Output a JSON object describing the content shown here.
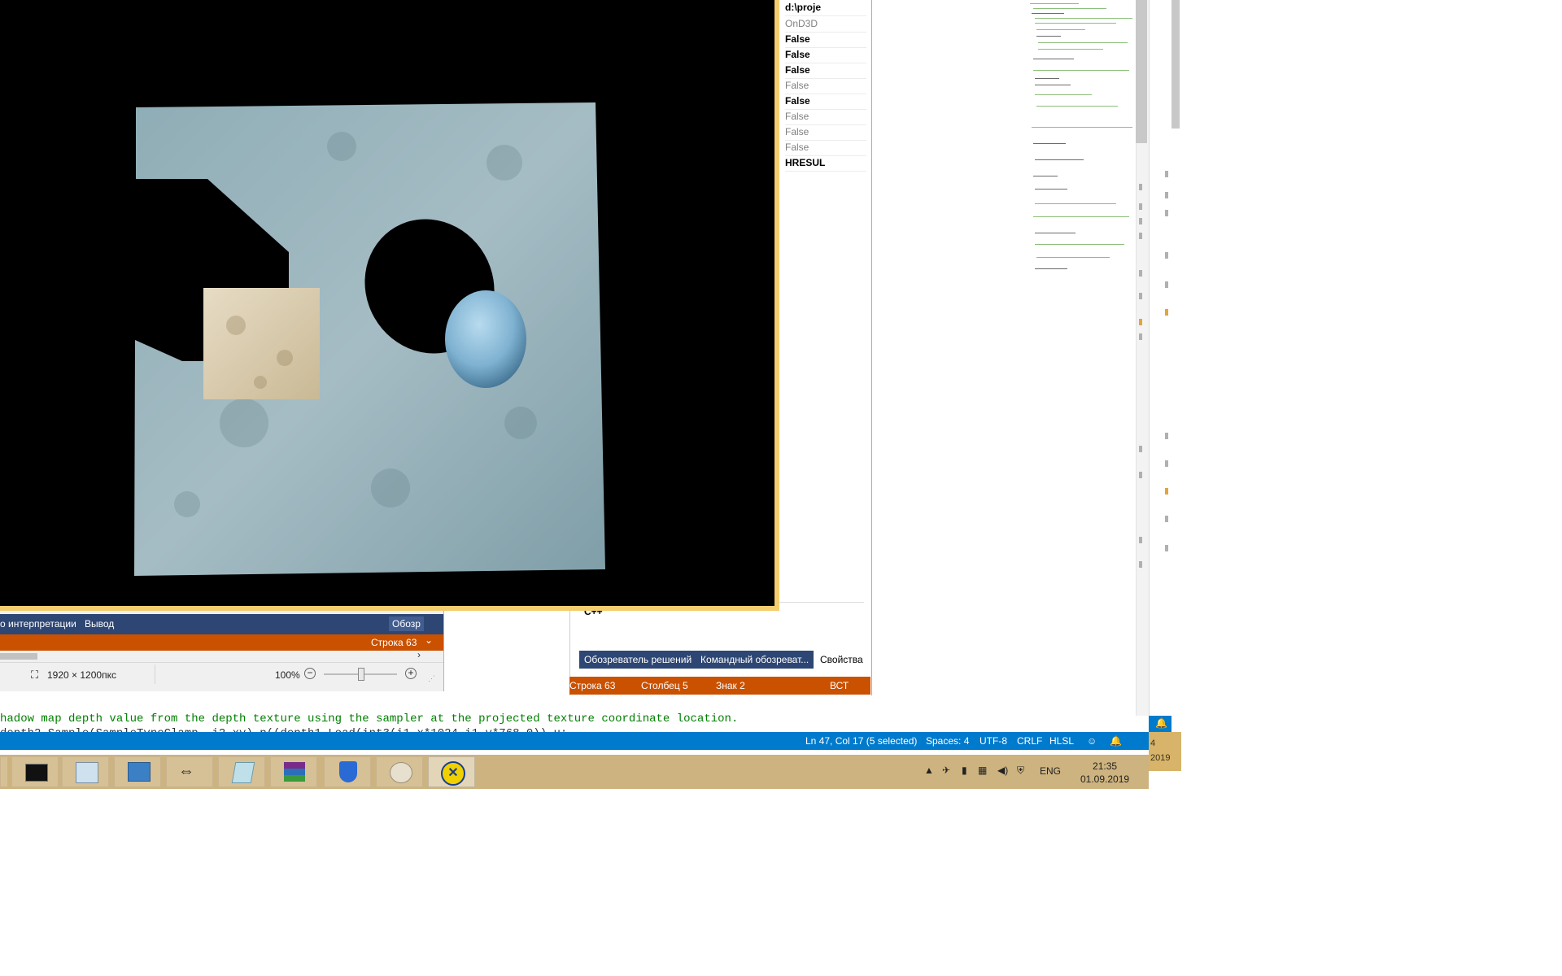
{
  "editor": {
    "code_lines": [
      "hadow map depth value from the depth texture using the sampler at the projected texture coordinate location.",
      "   depth2.Sample(SampleTypeClamp, i2.xy) p((depth1 Load(int3(i1.x*1024.i1.y*768.0)) u;"
    ],
    "status": {
      "position": "Ln 47, Col 17 (5 selected)",
      "spaces": "Spaces: 4",
      "encoding": "UTF-8",
      "eol": "CRLF",
      "language": "HLSL"
    }
  },
  "properties": {
    "values": [
      "d:\\proje",
      "OnD3D",
      "False",
      "False",
      "False",
      "False",
      "False",
      "False",
      "False",
      "False",
      "HRESUL"
    ],
    "bold_flags": [
      true,
      false,
      true,
      true,
      true,
      false,
      true,
      false,
      false,
      false,
      true
    ],
    "language": "C++",
    "tabs": [
      "Обозреватель решений",
      "Командный обозреват...",
      "Свойства"
    ],
    "status": {
      "line": "Строка 63",
      "column": "Столбец 5",
      "char": "Знак 2",
      "mode": "ВСТ"
    }
  },
  "viewer": {
    "tabs": [
      "о интерпретации",
      "Вывод",
      "Обозр"
    ],
    "line": "Строка 63",
    "image_size": "1920 × 1200пкс",
    "zoom": "100%",
    "zoom_level": 0.5
  },
  "taskbar": {
    "language": "ENG",
    "time": "21:35",
    "date": "01.09.2019",
    "year_fragment": "2019",
    "digit_fragment": "4"
  },
  "colors": {
    "vscode_status": "#007acc",
    "vs_status": "#ca5100",
    "vs_tab": "#2d4673",
    "render_border": "#f3cd6e",
    "taskbar": "#cdb37f"
  }
}
